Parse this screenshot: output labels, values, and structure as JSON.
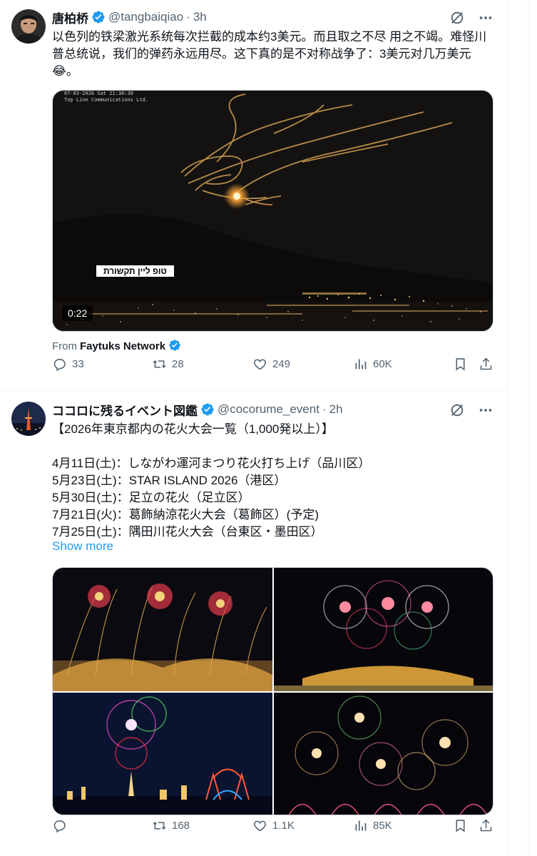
{
  "tweets": [
    {
      "name": "唐柏桥",
      "handle": "@tangbaiqiao",
      "dot": "·",
      "time": "3h",
      "text": "以色列的铁梁激光系统每次拦截的成本约3美元。而且取之不尽 用之不竭。难怪川普总统说，我们的弹药永远用尽。这下真的是不对称战争了：3美元对几万美元😂。",
      "video": {
        "duration": "0:22",
        "overlay_tag": "טופ ליין תקשורת",
        "stamp_line1": "07-03-2026 Sat 21:30:30",
        "stamp_line2": "Top Line Communications Ltd."
      },
      "from_label": "From",
      "from_source": "Faytuks Network",
      "stats": {
        "replies": "33",
        "reposts": "28",
        "likes": "249",
        "views": "60K"
      }
    },
    {
      "name": "ココロに残るイベント図鑑",
      "handle": "@cocorume_event",
      "dot": "·",
      "time": "2h",
      "text": "【2026年東京都内の花火大会一覧（1,000発以上）】\n\n4月11日(土)：しながわ運河まつり花火打ち上げ（品川区）\n5月23日(土)：STAR ISLAND 2026（港区）\n5月30日(土)：足立の花火（足立区）\n7月21日(火)：葛飾納涼花火大会（葛飾区）(予定)\n7月25日(土)：隅田川花火大会（台東区・墨田区）",
      "show_more": "Show more",
      "stats": {
        "replies": "",
        "reposts": "168",
        "likes": "1.1K",
        "views": "85K"
      }
    }
  ],
  "icons": {
    "verified": "verified-badge-icon",
    "grok": "grok-icon",
    "more": "more-icon",
    "reply": "reply-icon",
    "repost": "repost-icon",
    "like": "like-icon",
    "views": "views-icon",
    "bookmark": "bookmark-icon",
    "share": "share-icon"
  },
  "colors": {
    "accent": "#1d9bf0",
    "text": "#0f1419",
    "muted": "#536471",
    "border": "#eff3f4"
  }
}
